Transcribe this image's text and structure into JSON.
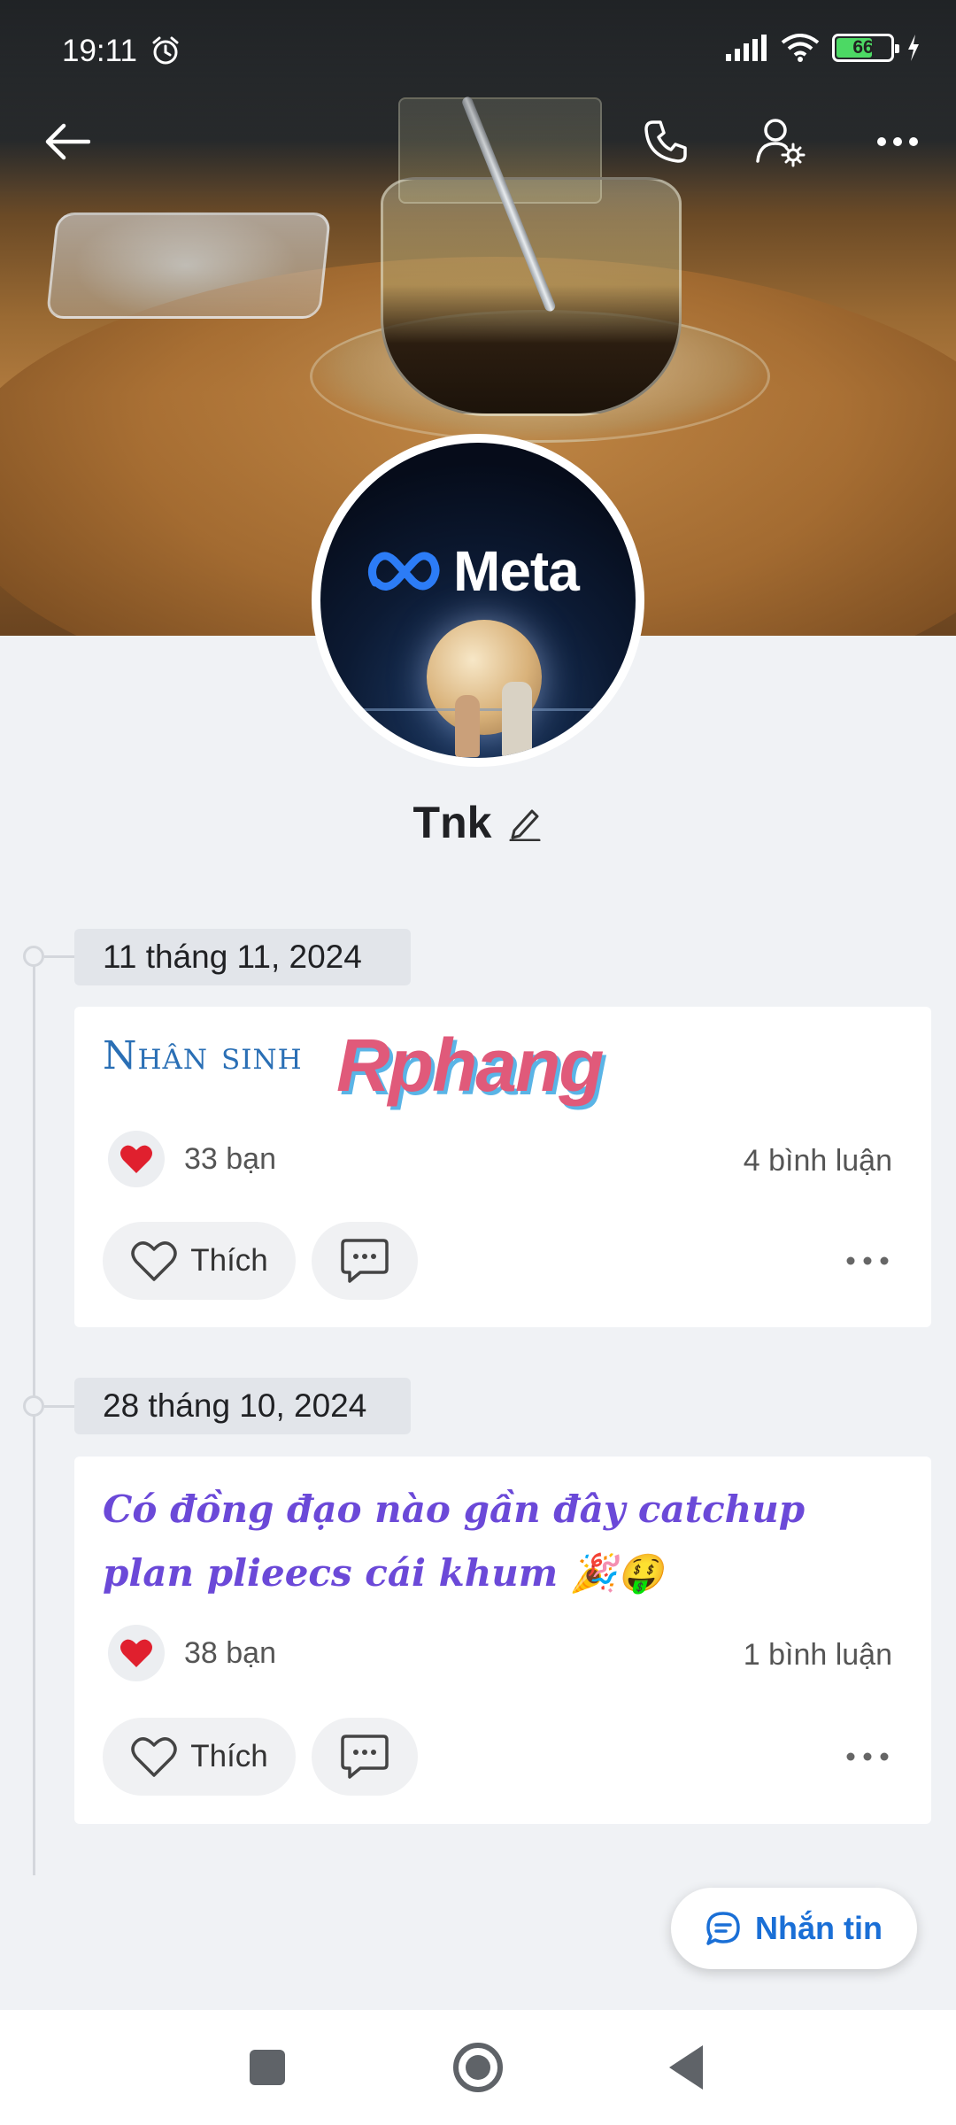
{
  "status_bar": {
    "time": "19:11",
    "battery": "66"
  },
  "profile": {
    "name": "Tnk",
    "avatar_logo_text": "Meta"
  },
  "posts": [
    {
      "date": "11 tháng 11, 2024",
      "text": "Nhân sinh",
      "sticker_text": "Rphang",
      "reactions": "33 bạn",
      "comments": "4 bình luận",
      "like_label": "Thích"
    },
    {
      "date": "28 tháng 10, 2024",
      "text": "Có đồng đạo nào gần đây catchup plan plieecs cái khum 🎉🤑",
      "reactions": "38 bạn",
      "comments": "1 bình luận",
      "like_label": "Thích"
    }
  ],
  "message_button": {
    "label": "Nhắn tin"
  },
  "colors": {
    "accent": "#1a6fd6",
    "post2_text": "#6b49d8",
    "post1_text": "#2a6fb5",
    "heart": "#e0202e"
  },
  "icons": [
    "back-arrow-icon",
    "phone-icon",
    "user-settings-icon",
    "more-icon",
    "edit-pencil-icon",
    "heart-icon",
    "comment-icon",
    "chat-icon"
  ]
}
